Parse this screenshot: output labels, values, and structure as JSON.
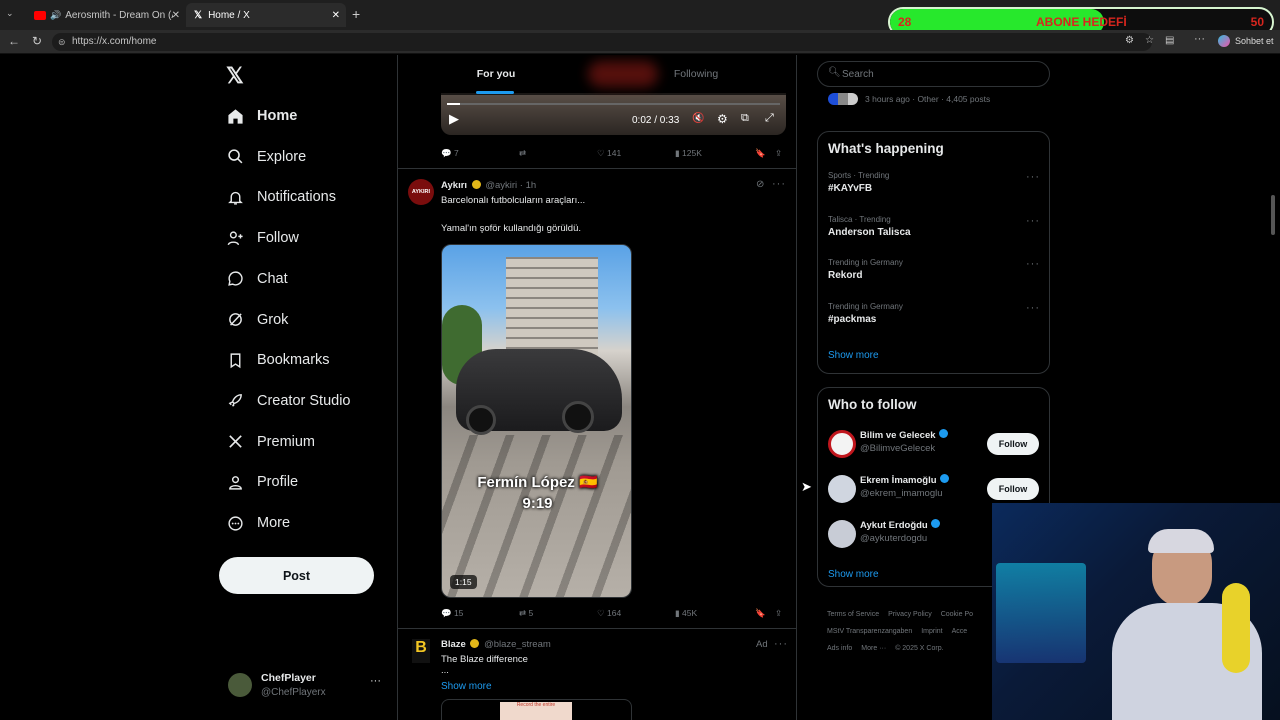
{
  "browser": {
    "tabs": [
      {
        "title": "Aerosmith - Dream On (Audio",
        "active": false
      },
      {
        "title": "Home / X",
        "active": true
      }
    ],
    "url": "https://x.com/home",
    "profile_label": "Sohbet et"
  },
  "overlay": {
    "sub_count": "28",
    "goal_label": "ABONE HEDEFİ",
    "goal_target": "50",
    "progress": 0.56
  },
  "nav": {
    "items": [
      {
        "label": "Home",
        "icon": "home-icon"
      },
      {
        "label": "Explore",
        "icon": "search-icon"
      },
      {
        "label": "Notifications",
        "icon": "bell-icon"
      },
      {
        "label": "Follow",
        "icon": "add-person-icon"
      },
      {
        "label": "Chat",
        "icon": "chat-icon"
      },
      {
        "label": "Grok",
        "icon": "grok-icon"
      },
      {
        "label": "Bookmarks",
        "icon": "bookmark-icon"
      },
      {
        "label": "Creator Studio",
        "icon": "rocket-icon"
      },
      {
        "label": "Premium",
        "icon": "x-logo-icon"
      },
      {
        "label": "Profile",
        "icon": "person-icon"
      },
      {
        "label": "More",
        "icon": "more-circle-icon"
      }
    ],
    "post_label": "Post",
    "account": {
      "name": "ChefPlayer",
      "handle": "@ChefPlayerx"
    }
  },
  "feed": {
    "tabs": [
      "For you",
      "Following"
    ],
    "video": {
      "time": "0:02 / 0:33"
    },
    "top_stats": {
      "replies": "7",
      "likes": "141",
      "views": "125K"
    },
    "tweet": {
      "name": "Aykırı",
      "handle": "@aykiri",
      "time": "1h",
      "avatar_text": "AYKIRI",
      "line1": "Barcelonalı futbolcuların araçları...",
      "line2": "Yamal'ın şoför kullandığı görüldü.",
      "media_caption_1": "Fermín López 🇪🇸",
      "media_caption_2": "9:19",
      "duration": "1:15",
      "replies": "15",
      "reposts": "5",
      "likes": "164",
      "views": "45K"
    },
    "ad": {
      "name": "Blaze",
      "handle": "@blaze_stream",
      "label": "Ad",
      "text": "The Blaze difference",
      "ellipsis": "...",
      "show_more": "Show more",
      "thumb_text": "Record the entire"
    }
  },
  "right": {
    "search_placeholder": "Search",
    "trend_meta": "3 hours ago · Other · 4,405 posts",
    "whats_happening": "What's happening",
    "trends": [
      {
        "cat": "Sports · Trending",
        "name": "#KAYvFB"
      },
      {
        "cat": "Talisca · Trending",
        "name": "Anderson Talisca"
      },
      {
        "cat": "Trending in Germany",
        "name": "Rekord"
      },
      {
        "cat": "Trending in Germany",
        "name": "#packmas"
      }
    ],
    "show_more": "Show more",
    "who_to_follow": "Who to follow",
    "follow_list": [
      {
        "name": "Bilim ve Gelecek",
        "handle": "@BilimveGelecek",
        "button": "Follow"
      },
      {
        "name": "Ekrem İmamoğlu",
        "handle": "@ekrem_imamoglu",
        "button": "Follow"
      },
      {
        "name": "Aykut Erdoğdu",
        "handle": "@aykuterdogdu",
        "button": ""
      }
    ],
    "show_more_2": "Show more",
    "footer": {
      "row1": [
        "Terms of Service",
        "Privacy Policy",
        "Cookie Po"
      ],
      "row2": [
        "MStV Transparenzangaben",
        "Imprint",
        "Acce"
      ],
      "row3": [
        "Ads info",
        "More ···",
        "© 2025 X Corp."
      ]
    }
  },
  "colors": {
    "accent": "#1d9bf0",
    "background": "#000000",
    "goal_green": "#27e82c"
  }
}
